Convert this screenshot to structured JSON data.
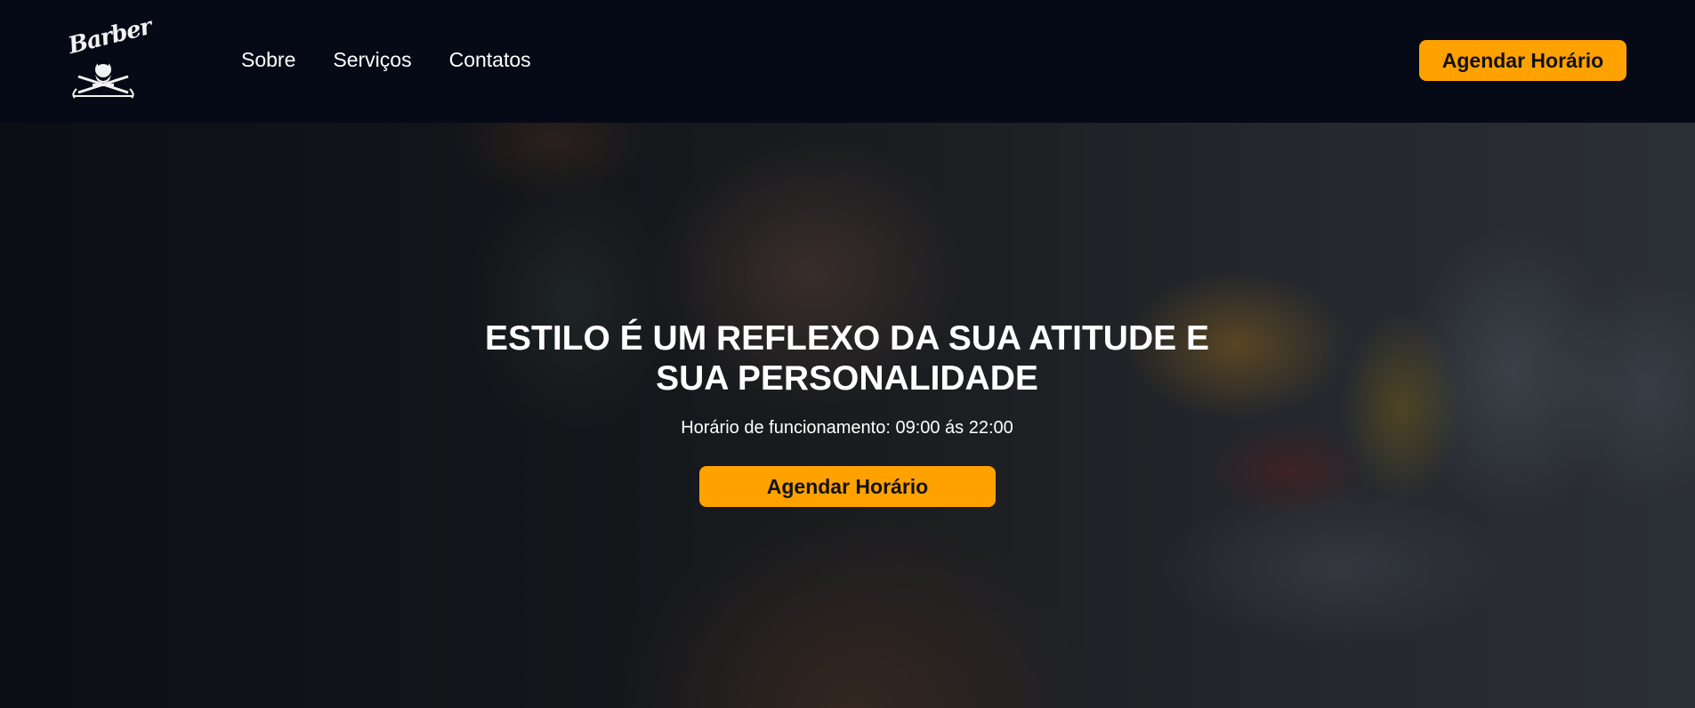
{
  "header": {
    "logo_text": "Barber",
    "nav": [
      {
        "label": "Sobre"
      },
      {
        "label": "Serviços"
      },
      {
        "label": "Contatos"
      }
    ],
    "cta_label": "Agendar Horário"
  },
  "hero": {
    "title": "ESTILO É UM REFLEXO DA SUA ATITUDE E SUA PERSONALIDADE",
    "hours": "Horário de funcionamento: 09:00 ás 22:00",
    "cta_label": "Agendar Horário"
  },
  "colors": {
    "accent": "#ffa200",
    "header_bg": "#060916"
  },
  "icons": {
    "logo": "barber-logo-icon"
  }
}
